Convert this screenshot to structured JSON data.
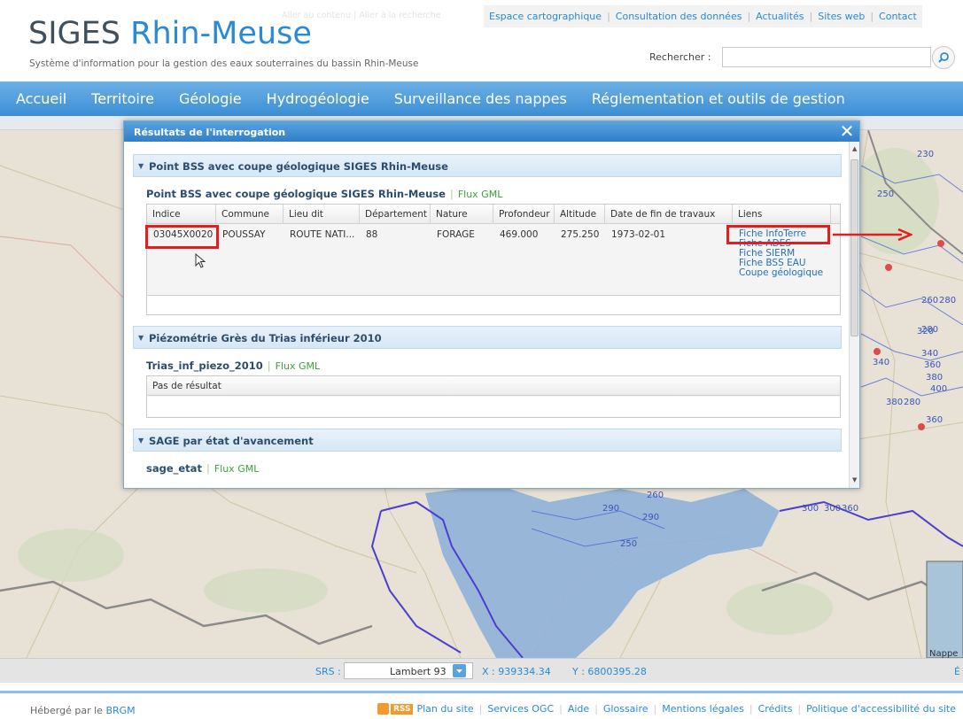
{
  "header": {
    "title_part1": "SIGES",
    "title_part2": "Rhin-Meuse",
    "subtitle": "Système d'information pour la gestion des eaux souterraines du bassin Rhin-Meuse",
    "skip_links": "Aller au contenu | Aller à la recherche",
    "top_links": [
      "Espace cartographique",
      "Consultation des données",
      "Actualités",
      "Sites web",
      "Contact"
    ],
    "search_label": "Rechercher :",
    "search_value": ""
  },
  "nav": {
    "items": [
      "Accueil",
      "Territoire",
      "Géologie",
      "Hydrogéologie",
      "Surveillance des nappes",
      "Réglementation et outils de gestion"
    ]
  },
  "dialog": {
    "title": "Résultats de l'interrogation",
    "close": "✕",
    "sections": [
      {
        "header": "Point BSS avec coupe géologique SIGES Rhin-Meuse",
        "layer_title": "Point BSS avec coupe géologique SIGES Rhin-Meuse",
        "flux": "Flux GML",
        "columns": [
          "Indice",
          "Commune",
          "Lieu dit",
          "Département",
          "Nature",
          "Profondeur",
          "Altitude",
          "Date de fin de travaux",
          "Liens"
        ],
        "rows": [
          {
            "indice": "03045X0020",
            "commune": "POUSSAY",
            "lieu_dit": "ROUTE NATI...",
            "departement": "88",
            "nature": "FORAGE",
            "profondeur": "469.000",
            "altitude": "275.250",
            "date_fin": "1973-02-01",
            "liens": [
              "Fiche InfoTerre",
              "Fiche ADES",
              "Fiche SIERM",
              "Fiche BSS EAU",
              "Coupe géologique"
            ]
          }
        ]
      },
      {
        "header": "Piézométrie Grès du Trias inférieur 2010",
        "layer_title": "Trias_inf_piezo_2010",
        "flux": "Flux GML",
        "columns": [
          "Pas de résultat"
        ]
      },
      {
        "header": "SAGE par état d'avancement",
        "layer_title": "sage_etat",
        "flux": "Flux GML"
      }
    ]
  },
  "map": {
    "contour_labels": [
      "230",
      "250",
      "260",
      "280",
      "280",
      "290",
      "290",
      "300",
      "320",
      "340",
      "340",
      "360",
      "360",
      "380",
      "380",
      "400",
      "250",
      "260",
      "280",
      "300",
      "360"
    ],
    "nappe_label": "Nappe"
  },
  "status": {
    "srs_label": "SRS :",
    "srs_value": "Lambert 93",
    "x": "X : 939334.34",
    "y": "Y : 6800395.28",
    "e": "É"
  },
  "footer": {
    "hosted_prefix": "Hébergé par le ",
    "hosted_org": "BRGM",
    "rss": "RSS",
    "links": [
      "Plan du site",
      "Services OGC",
      "Aide",
      "Glossaire",
      "Mentions légales",
      "Crédits",
      "Politique d'accessibilité du site"
    ]
  },
  "colors": {
    "accent": "#2a8ad6",
    "highlight": "#e02020",
    "nav": "#3a8ed4"
  }
}
